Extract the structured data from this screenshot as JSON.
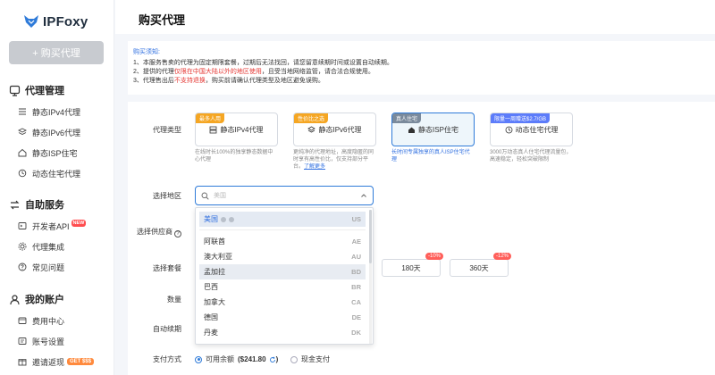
{
  "brand": {
    "name": "IPFoxy",
    "accent": "#2f7bd9"
  },
  "sidebar": {
    "buy_button": "+ 购买代理",
    "groups": [
      {
        "title": "代理管理",
        "icon": "proxy-icon"
      },
      {
        "title": "自助服务",
        "icon": "swap-icon"
      },
      {
        "title": "我的账户",
        "icon": "user-icon"
      }
    ],
    "items": [
      {
        "label": "静态IPv4代理"
      },
      {
        "label": "静态IPv6代理"
      },
      {
        "label": "静态ISP住宅"
      },
      {
        "label": "动态住宅代理"
      },
      {
        "label": "开发者API",
        "badge": "NEW"
      },
      {
        "label": "代理集成"
      },
      {
        "label": "常见问题"
      },
      {
        "label": "费用中心"
      },
      {
        "label": "账号设置"
      },
      {
        "label": "邀请返现",
        "badge": "GET $$$"
      }
    ]
  },
  "header": {
    "title": "购买代理"
  },
  "notice": {
    "title": "购买须知:",
    "line1": "1、本服务售卖的代理为固定期限套餐，过期后无法找回，请您留意续期时间或设置自动续期。",
    "line2_pre": "2、提供的代理",
    "line2_red": "仅限在中国大陆以外的地区使用",
    "line2_post": "，且受当地网络监管，请合法合规使用。",
    "line3_pre": "3、代理售出后",
    "line3_red": "不支持退换",
    "line3_post": "，购买前请确认代理类型及地区避免误购。"
  },
  "form": {
    "proxy_type_label": "代理类型",
    "region_label": "选择地区",
    "provider_label": "选择供应商",
    "package_label": "选择套餐",
    "quantity_label": "数量",
    "auto_renew_label": "自动续期",
    "payment_label": "支付方式"
  },
  "proxy_types": [
    {
      "tag": "最多人用",
      "tag_color": "#f5a623",
      "name": "静态IPv4代理",
      "desc": "在线时长100%的独享静态数据中心代理"
    },
    {
      "tag": "性价比之选",
      "tag_color": "#f5a623",
      "name": "静态IPv6代理",
      "desc": "更纯净的代理地址，高度隐匿的同时享有高性价比，仅支持部分平台。",
      "link": "了解更多"
    },
    {
      "tag": "真人住宅",
      "tag_color": "#7a8a9c",
      "name": "静态ISP住宅",
      "desc": "长时间专属独享的真人ISP住宅代理"
    },
    {
      "tag": "限量一周赠送$2.7/GB",
      "tag_color": "#5c7cfa",
      "name": "动态住宅代理",
      "desc": "3000万动态真人住宅代理流量包，高速稳定，轻松突破限制"
    }
  ],
  "region_search": {
    "placeholder": "美国"
  },
  "region_options": [
    {
      "name": "美国",
      "code": "US"
    },
    {
      "name": "阿联酋",
      "code": "AE"
    },
    {
      "name": "澳大利亚",
      "code": "AU"
    },
    {
      "name": "孟加拉",
      "code": "BD"
    },
    {
      "name": "巴西",
      "code": "BR"
    },
    {
      "name": "加拿大",
      "code": "CA"
    },
    {
      "name": "德国",
      "code": "DE"
    },
    {
      "name": "丹麦",
      "code": "DK"
    }
  ],
  "packages": [
    {
      "label": "180天",
      "discount": "-10%"
    },
    {
      "label": "360天",
      "discount": "-12%"
    }
  ],
  "payment": {
    "balance_label": "可用余额",
    "balance_amount": "($241.80",
    "balance_close": ")",
    "cash_label": "现金支付"
  }
}
